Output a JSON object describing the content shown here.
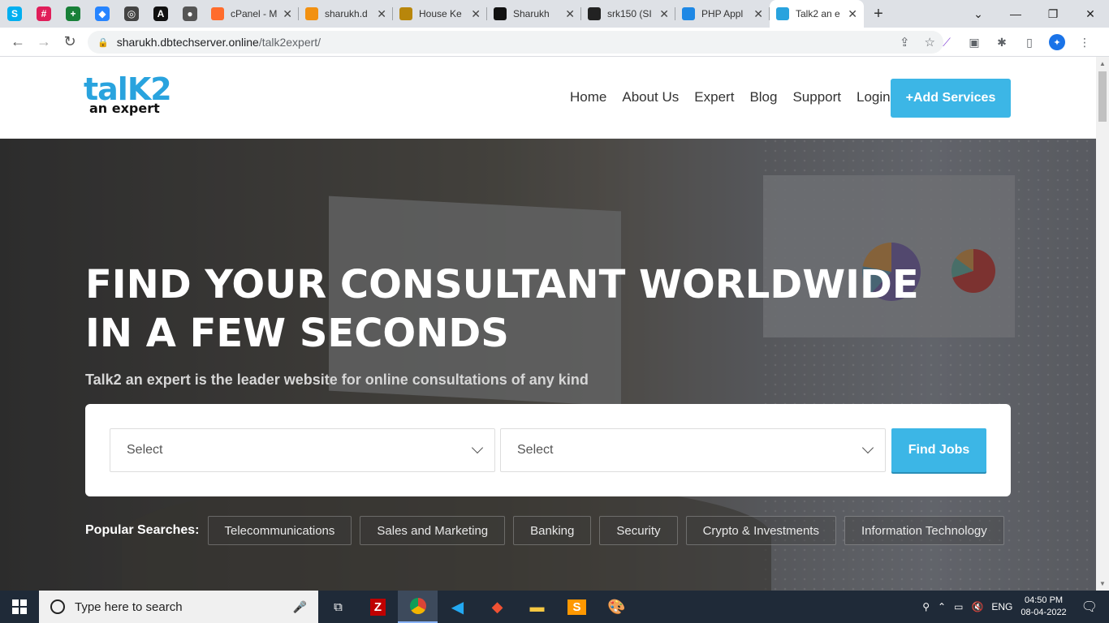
{
  "browser": {
    "pinned": [
      {
        "name": "skype",
        "glyph": "S",
        "color": "#00aff0"
      },
      {
        "name": "slack",
        "glyph": "#",
        "color": "#e01e5a"
      },
      {
        "name": "sheets",
        "glyph": "+",
        "color": "#188038"
      },
      {
        "name": "jira",
        "glyph": "◆",
        "color": "#2684ff"
      },
      {
        "name": "circle",
        "glyph": "◎",
        "color": "#444"
      },
      {
        "name": "font",
        "glyph": "A",
        "color": "#111"
      },
      {
        "name": "globe",
        "glyph": "●",
        "color": "#555"
      }
    ],
    "tabs": [
      {
        "title": "cPanel - M",
        "icon": "cPanel",
        "color": "#ff6c2c",
        "active": false
      },
      {
        "title": "sharukh.d",
        "icon": "pma",
        "color": "#f29111",
        "active": false
      },
      {
        "title": "House Ke",
        "icon": "hk",
        "color": "#b8860b",
        "active": false
      },
      {
        "title": "Sharukh",
        "icon": "H",
        "color": "#111",
        "active": false
      },
      {
        "title": "srk150 (SI",
        "icon": "gh",
        "color": "#222",
        "active": false
      },
      {
        "title": "PHP Appl",
        "icon": "isbt",
        "color": "#1e88e5",
        "active": false
      },
      {
        "title": "Talk2 an e",
        "icon": "talk2",
        "color": "#29a3de",
        "active": true
      }
    ],
    "new_tab": "+",
    "url_host": "sharukh.dbtechserver.online",
    "url_path": "/talk2expert/"
  },
  "site": {
    "logo_top": "talK2",
    "logo_bottom": "an expert",
    "menu": [
      "Home",
      "About Us",
      "Expert",
      "Blog",
      "Support",
      "Login"
    ],
    "add_services": "+Add Services",
    "headline_1": "FIND YOUR CONSULTANT WORLDWIDE",
    "headline_2": "IN A FEW SECONDS",
    "subtitle": "Talk2 an expert is the leader website for online consultations of any kind",
    "select_1": "Select",
    "select_2": "Select",
    "find_button": "Find Jobs",
    "popular_label": "Popular Searches:",
    "popular": [
      "Telecommunications",
      "Sales and Marketing",
      "Banking",
      "Security",
      "Crypto & Investments",
      "Information Technology"
    ]
  },
  "taskbar": {
    "search_placeholder": "Type here to search",
    "language": "ENG",
    "time": "04:50 PM",
    "date": "08-04-2022"
  },
  "colors": {
    "accent": "#3cb6e6",
    "logo": "#29a3de"
  }
}
